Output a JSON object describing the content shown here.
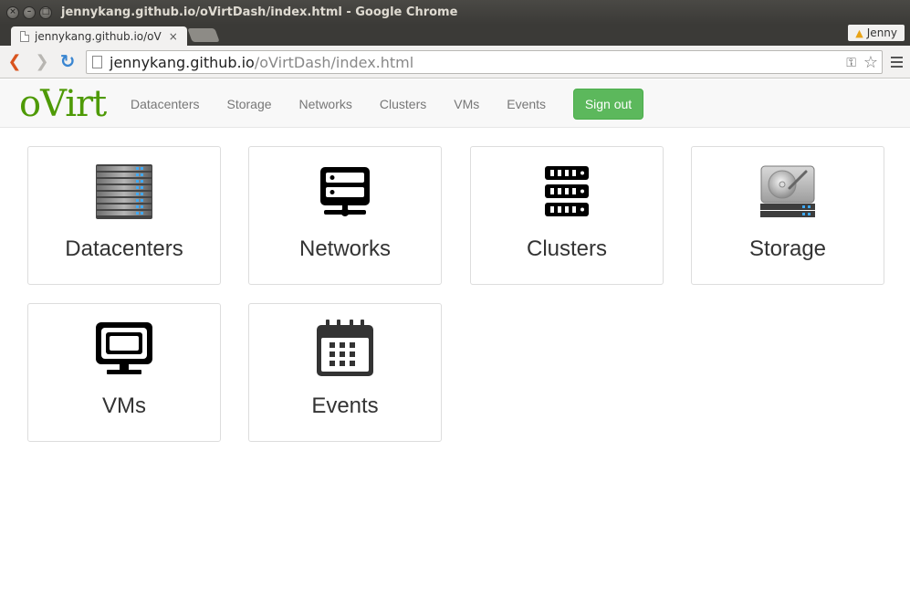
{
  "window": {
    "title": "jennykang.github.io/oVirtDash/index.html - Google Chrome",
    "close_glyph": "×",
    "minimize_glyph": "–",
    "maximize_glyph": "□"
  },
  "tab": {
    "label": "jennykang.github.io/oV",
    "close_glyph": "×"
  },
  "profile": {
    "name": "Jenny",
    "warning_glyph": "▲"
  },
  "toolbar": {
    "back_glyph": "❮",
    "forward_glyph": "❯",
    "reload_glyph": "↻",
    "url_host": "jennykang.github.io",
    "url_path": "/oVirtDash/index.html",
    "key_glyph": "⚿",
    "star_glyph": "☆"
  },
  "navbar": {
    "brand": "oVirt",
    "links": [
      "Datacenters",
      "Storage",
      "Networks",
      "Clusters",
      "VMs",
      "Events"
    ],
    "signout_label": "Sign out",
    "signout_color": "#5cb85c",
    "brand_color": "#4e9a06"
  },
  "tiles": [
    {
      "label": "Datacenters",
      "icon": "server-rack-icon"
    },
    {
      "label": "Networks",
      "icon": "network-server-icon"
    },
    {
      "label": "Clusters",
      "icon": "server-stack-icon"
    },
    {
      "label": "Storage",
      "icon": "hard-drive-icon"
    },
    {
      "label": "VMs",
      "icon": "monitor-icon"
    },
    {
      "label": "Events",
      "icon": "calendar-icon"
    }
  ]
}
